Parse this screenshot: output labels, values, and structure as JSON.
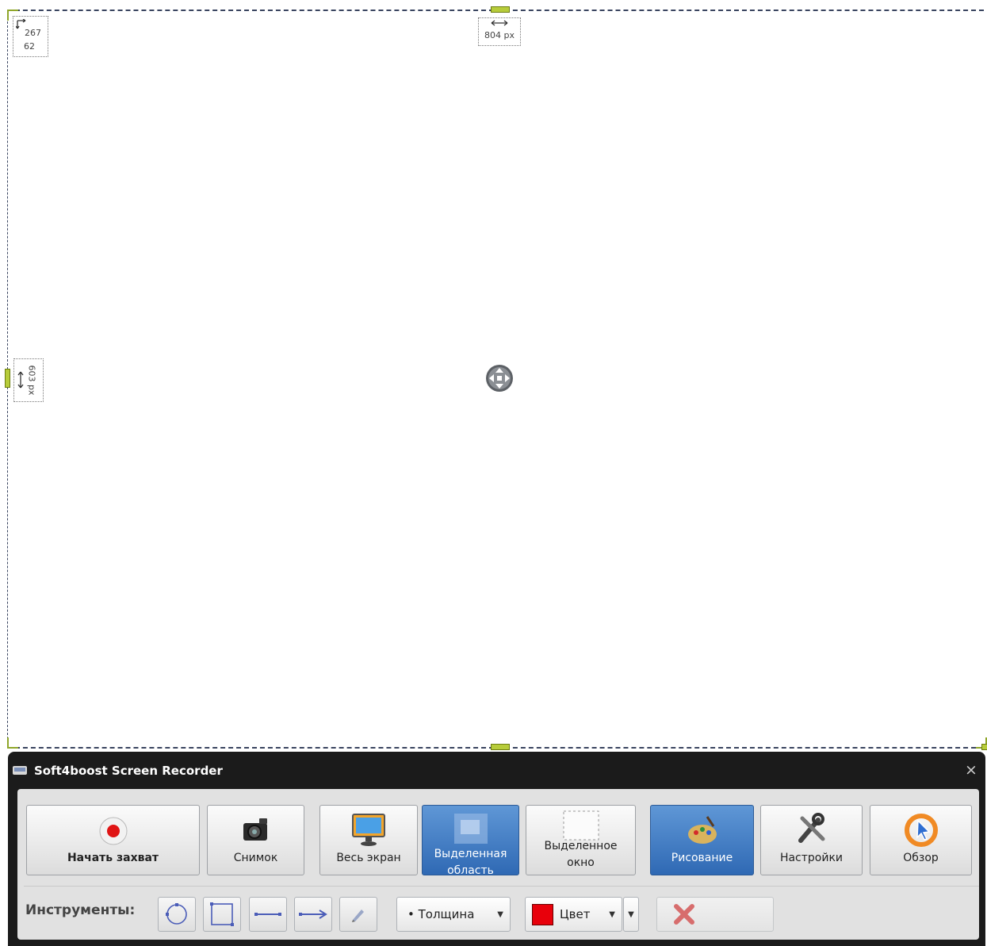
{
  "overlay": {
    "corner_info_line1": "267",
    "corner_info_line2": "62",
    "width_label": "804 px",
    "height_label": "603 px"
  },
  "window": {
    "title": "Soft4boost Screen Recorder",
    "close_symbol": "×"
  },
  "toolbar": {
    "start_capture": "Начать захват",
    "snapshot": "Снимок",
    "full_screen": "Весь экран",
    "selected_area": "Выделенная область",
    "selected_window": "Выделенное окно",
    "drawing": "Рисование",
    "settings": "Настройки",
    "browse": "Обзор"
  },
  "tools": {
    "label": "Инструменты:",
    "thickness": "• Толщина",
    "color": "Цвет",
    "color_value": "#e8000b"
  },
  "icons": [
    "record-icon",
    "camera-icon",
    "monitor-icon",
    "selection-area-icon",
    "selection-window-icon",
    "paint-palette-icon",
    "tools-wrench-icon",
    "cursor-browse-icon",
    "ellipse-tool-icon",
    "rectangle-tool-icon",
    "line-tool-icon",
    "arrow-tool-icon",
    "pen-tool-icon",
    "clear-x-icon",
    "move-icon",
    "window-app-icon"
  ]
}
